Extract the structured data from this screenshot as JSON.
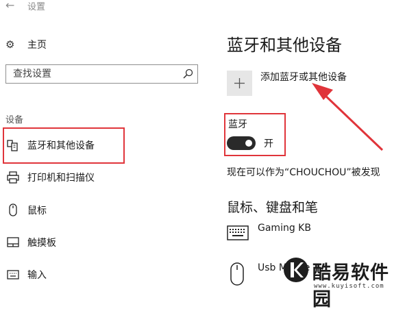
{
  "window": {
    "title": "设置",
    "back_icon": "back-arrow-icon"
  },
  "sidebar": {
    "home": {
      "icon": "gear-icon",
      "label": "主页"
    },
    "search": {
      "placeholder": "查找设置",
      "icon": "search-icon"
    },
    "section_label": "设备",
    "items": [
      {
        "icon": "bluetooth-devices-icon",
        "label": "蓝牙和其他设备",
        "selected": true
      },
      {
        "icon": "printer-icon",
        "label": "打印机和扫描仪"
      },
      {
        "icon": "mouse-icon",
        "label": "鼠标"
      },
      {
        "icon": "touchpad-icon",
        "label": "触摸板"
      },
      {
        "icon": "keyboard-icon",
        "label": "输入"
      }
    ]
  },
  "main": {
    "title": "蓝牙和其他设备",
    "add_device": {
      "icon": "plus-icon",
      "label": "添加蓝牙或其他设备"
    },
    "bluetooth": {
      "label": "蓝牙",
      "state": "开",
      "on": true
    },
    "discoverable_text": "现在可以作为“CHOUCHOU”被发现",
    "devices_section": "鼠标、键盘和笔",
    "devices": [
      {
        "icon": "keyboard-icon",
        "name": "Gaming KB"
      },
      {
        "icon": "mouse-icon",
        "name": "Usb Mouse"
      }
    ]
  },
  "annotations": {
    "highlight_color": "#e0343a"
  },
  "watermark": {
    "text": "酷易软件园",
    "url": "www.kuyisoft.com"
  }
}
